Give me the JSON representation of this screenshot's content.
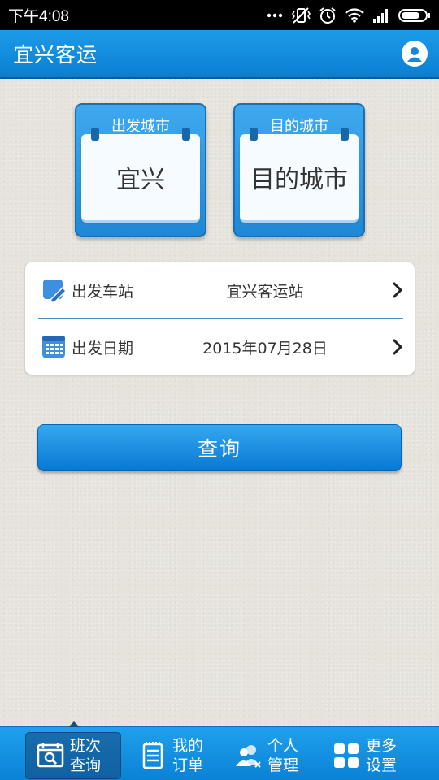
{
  "status_bar": {
    "time": "下午4:08",
    "icons": [
      "more-dots-icon",
      "vibrate-icon",
      "alarm-icon",
      "wifi-icon",
      "signal-icon",
      "battery-icon"
    ]
  },
  "app_bar": {
    "title": "宜兴客运",
    "user_icon": "user-icon"
  },
  "cities": {
    "from": {
      "label": "出发城市",
      "value": "宜兴"
    },
    "to": {
      "label": "目的城市",
      "value": "目的城市"
    }
  },
  "form": {
    "station": {
      "label": "出发车站",
      "value": "宜兴客运站",
      "icon": "edit-icon"
    },
    "date": {
      "label": "出发日期",
      "value": "2015年07月28日",
      "icon": "calendar-icon"
    }
  },
  "query_button": {
    "label": "查询"
  },
  "bottom_nav": {
    "items": [
      {
        "line1": "班次",
        "line2": "查询",
        "icon": "schedule-search-icon",
        "active": true
      },
      {
        "line1": "我的",
        "line2": "订单",
        "icon": "orders-icon",
        "active": false
      },
      {
        "line1": "个人",
        "line2": "管理",
        "icon": "users-icon",
        "active": false
      },
      {
        "line1": "更多",
        "line2": "设置",
        "icon": "grid-icon",
        "active": false
      }
    ]
  },
  "colors": {
    "primary": "#0a7fd2",
    "primary_light": "#36a7ef",
    "background": "#e6e3dc",
    "divider": "#4e8fbf"
  }
}
